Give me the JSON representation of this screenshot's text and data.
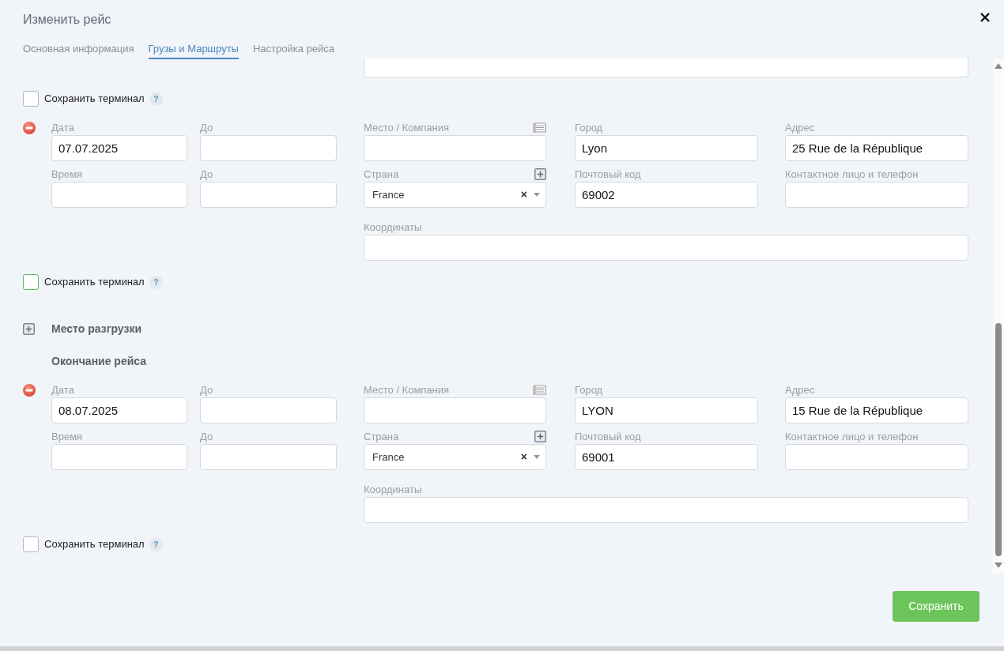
{
  "dialog": {
    "title": "Изменить рейс"
  },
  "tabs": [
    {
      "label": "Основная информация",
      "selected": false
    },
    {
      "label": "Грузы и Маршруты",
      "selected": true
    },
    {
      "label": "Настройка рейса",
      "selected": false
    }
  ],
  "items": [
    {
      "kind": "field-stub"
    },
    {
      "kind": "checkbox",
      "label": "Сохранить терминал",
      "help": "?",
      "checked": false,
      "color": "#b5b9bd"
    },
    {
      "kind": "stop",
      "rows": [
        [
          {
            "kind": "text",
            "label": "Дата",
            "value": "07.07.2025"
          },
          {
            "kind": "text",
            "label": "До"
          },
          {
            "kind": "company",
            "label": "Место / Компания"
          },
          {
            "kind": "text",
            "label": "Город",
            "value": "Lyon"
          },
          {
            "kind": "text",
            "label": "Адрес",
            "value": "25 Rue de la République"
          }
        ],
        [
          {
            "kind": "text",
            "label": "Время"
          },
          {
            "kind": "text",
            "label": "До"
          },
          {
            "kind": "select",
            "label": "Страна",
            "value": "France",
            "clear": "×"
          },
          {
            "kind": "text",
            "label": "Почтовый код",
            "value": "69002"
          },
          {
            "kind": "text",
            "label": "Контактное лицо и телефон"
          }
        ],
        [
          null,
          null,
          {
            "kind": "wide",
            "label": "Координаты"
          }
        ]
      ]
    },
    {
      "kind": "checkbox",
      "label": "Сохранить терминал",
      "help": "?",
      "checked": false,
      "color": "#5cb85c"
    },
    {
      "kind": "add",
      "label": "Место разгрузки"
    },
    {
      "kind": "heading",
      "label": "Окончание рейса"
    },
    {
      "kind": "stop",
      "rows": [
        [
          {
            "kind": "text",
            "label": "Дата",
            "value": "08.07.2025"
          },
          {
            "kind": "text",
            "label": "До"
          },
          {
            "kind": "company",
            "label": "Место / Компания"
          },
          {
            "kind": "text",
            "label": "Город",
            "value": "LYON"
          },
          {
            "kind": "text",
            "label": "Адрес",
            "value": "15 Rue de la République"
          }
        ],
        [
          {
            "kind": "text",
            "label": "Время"
          },
          {
            "kind": "text",
            "label": "До"
          },
          {
            "kind": "select",
            "label": "Страна",
            "value": "France",
            "clear": "×"
          },
          {
            "kind": "text",
            "label": "Почтовый код",
            "value": "69001"
          },
          {
            "kind": "text",
            "label": "Контактное лицо и телефон"
          }
        ],
        [
          null,
          null,
          {
            "kind": "wide",
            "label": "Координаты"
          }
        ]
      ]
    },
    {
      "kind": "checkbox",
      "label": "Сохранить терминал",
      "help": "?",
      "checked": false,
      "color": "#b5b9bd"
    }
  ],
  "save_button": "Сохранить"
}
